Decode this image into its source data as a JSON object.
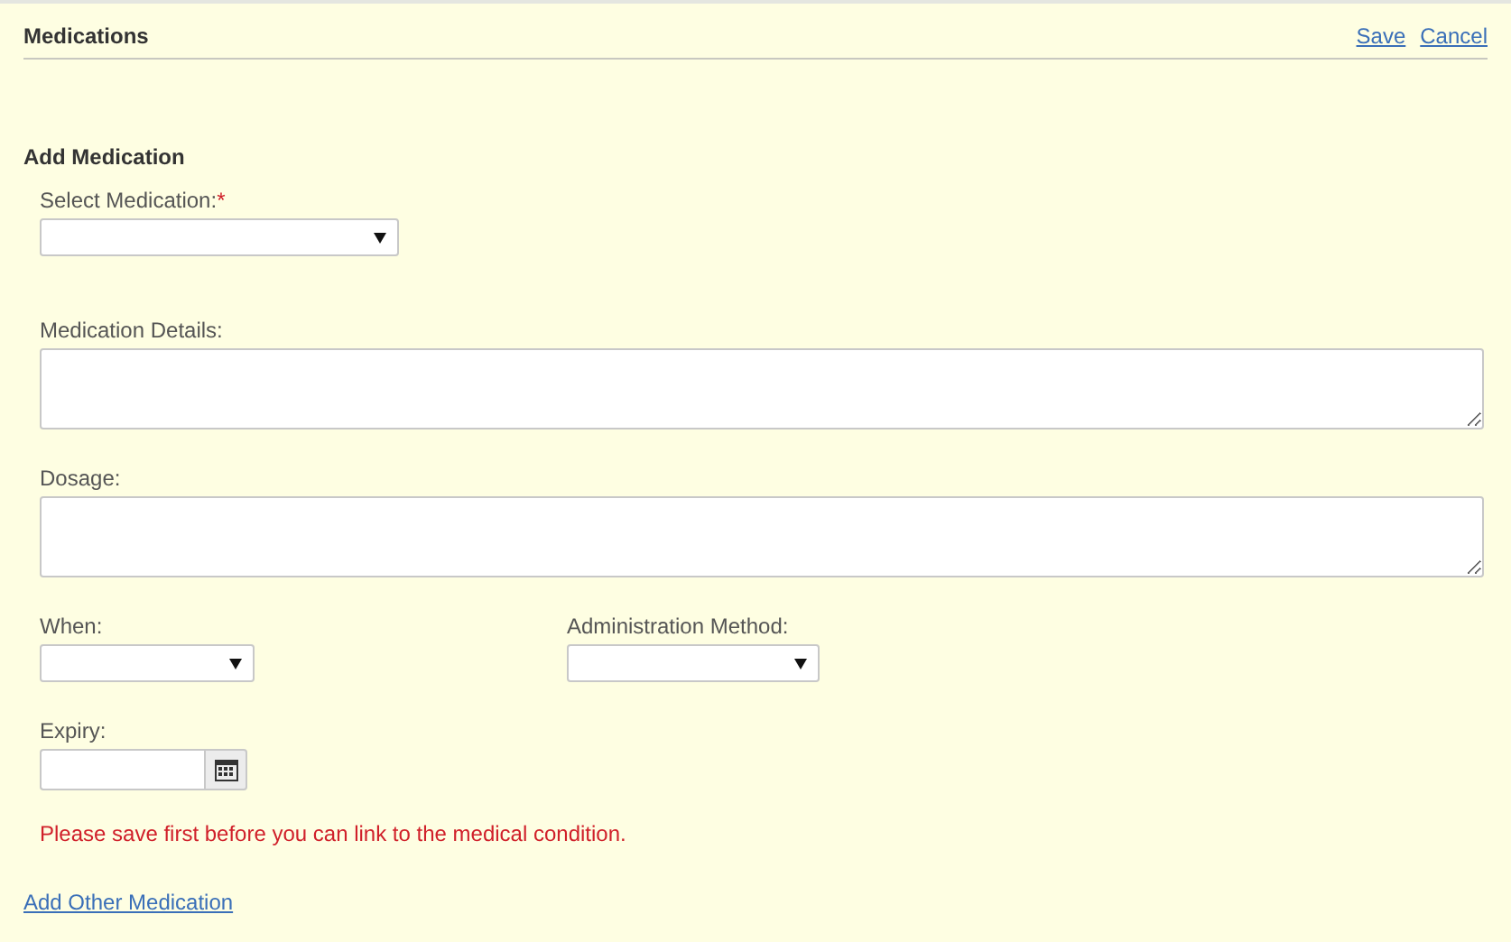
{
  "header": {
    "title": "Medications",
    "actions": [
      "Save",
      "Cancel"
    ]
  },
  "section_title": "Add Medication",
  "medication_select": {
    "label": "Select Medication:",
    "required_mark": "*"
  },
  "details": {
    "label": "Medication Details:"
  },
  "dosage": {
    "label": "Dosage:"
  },
  "when": {
    "label": "When:"
  },
  "administration_method": {
    "label": "Administration Method:"
  },
  "expiry": {
    "label": "Expiry:"
  },
  "warning": "Please save first before you can link to the medical condition.",
  "add_other_link": "Add Other Medication"
}
